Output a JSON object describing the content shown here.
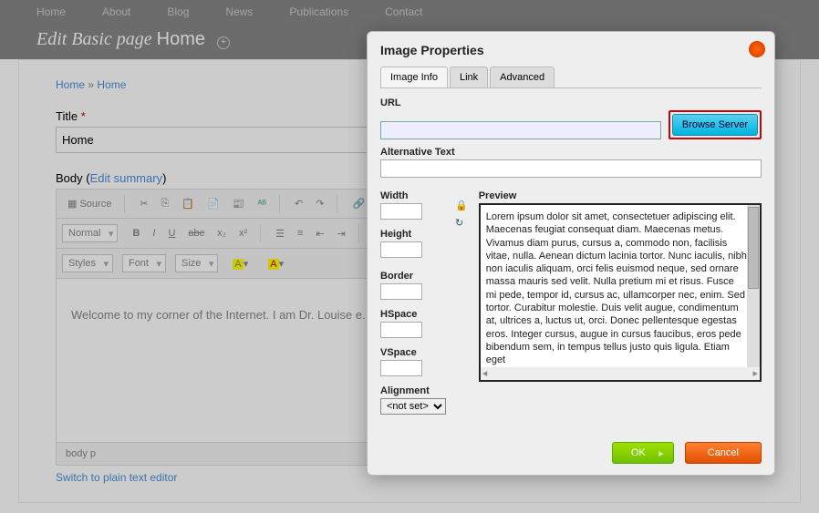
{
  "nav": {
    "items": [
      "Home",
      "About",
      "Blog",
      "News",
      "Publications",
      "Contact"
    ]
  },
  "pageTitle": {
    "prefix": "Edit Basic page",
    "name": "Home"
  },
  "breadcrumb": {
    "a": "Home",
    "b": "Home"
  },
  "title": {
    "label": "Title",
    "value": "Home"
  },
  "body": {
    "label": "Body",
    "editSummary": "Edit summary"
  },
  "toolbar": {
    "source": "Source",
    "normal": "Normal",
    "styles": "Styles",
    "font": "Font",
    "size": "Size"
  },
  "editorText": "Welcome to my corner of the Internet. I am Dr. Louise                                                                                             e. I wel projects or to speak on my past and current research",
  "status": "body  p",
  "switchLink": "Switch to plain text editor",
  "dialog": {
    "title": "Image Properties",
    "tabs": {
      "info": "Image Info",
      "link": "Link",
      "advanced": "Advanced"
    },
    "url": {
      "label": "URL",
      "value": ""
    },
    "browse": "Browse Server",
    "alt": {
      "label": "Alternative Text",
      "value": ""
    },
    "width": "Width",
    "height": "Height",
    "border": "Border",
    "hspace": "HSpace",
    "vspace": "VSpace",
    "alignment": {
      "label": "Alignment",
      "value": "<not set>"
    },
    "preview": {
      "label": "Preview",
      "text": "Lorem ipsum dolor sit amet, consectetuer adipiscing elit. Maecenas feugiat consequat diam. Maecenas metus. Vivamus diam purus, cursus a, commodo non, facilisis vitae, nulla. Aenean dictum lacinia tortor. Nunc iaculis, nibh non iaculis aliquam, orci felis euismod neque, sed ornare massa mauris sed velit. Nulla pretium mi et risus. Fusce mi pede, tempor id, cursus ac, ullamcorper nec, enim. Sed tortor. Curabitur molestie. Duis velit augue, condimentum at, ultrices a, luctus ut, orci. Donec pellentesque egestas eros. Integer cursus, augue in cursus faucibus, eros pede bibendum sem, in tempus tellus justo quis ligula. Etiam eget"
    },
    "ok": "OK",
    "cancel": "Cancel"
  }
}
